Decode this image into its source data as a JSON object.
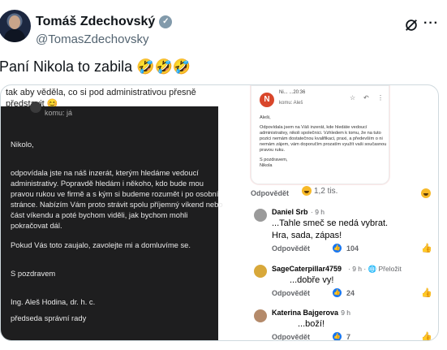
{
  "header": {
    "name": "Tomáš Zdechovský",
    "handle": "@TomasZdechovsky",
    "verified_color": "#829aab",
    "icons": [
      "grok-icon",
      "more-icon"
    ]
  },
  "tweet": {
    "text": "Paní Nikola to zabila 🤣🤣🤣"
  },
  "media": {
    "top_text_1": "tak aby věděla, co si pod administrativou přesně",
    "top_text_2": "představit 😊",
    "dark_email": {
      "to": "komu: já",
      "greeting": "Nikolo,",
      "p1": [
        "odpovídala jste na náš inzerát, kterým hledáme vedoucí",
        "administrativy. Popravdě hledám i někoho, kdo bude mou",
        "pravou rukou ve firmě a s kým si budeme rozumět i po osobní",
        "stránce. Nabízím Vám proto strávit spolu příjemný víkend nebo",
        "část víkendu a poté bychom viděli, jak bychom mohli",
        "pokračovat dál."
      ],
      "p2": "Pokud Vás toto zaujalo, zavolejte mi a domluvíme se.",
      "closing": "S pozdravem",
      "signature": "Ing. Aleš Hodina, dr. h. c.",
      "role": "předseda správní rady"
    },
    "reply_email": {
      "avatar_letter": "N",
      "sender": "Ni...   ...20:36",
      "to": "komu: Aleš",
      "greeting": "Aleši,",
      "body": "Odpovídala jsem na Váš inzerát, kde hledáte vedoucí administrativy, nikoli společnici. Vzhledem k tomu, že na tuto pozici nemám dostatečnou kvalifikaci, praxi, a především o ni nemám zájem, vám doporučím prozatím využít vaši současnou pravou ruku.",
      "closing": "S pozdravem,",
      "signature": "Nikola"
    },
    "post_actions": {
      "reply": "Odpovědět",
      "reaction_count": "1,2 tis."
    },
    "comments": [
      {
        "name": "Daniel Srb",
        "meta": "· 9 h",
        "text": "...Tahle smeč se nedá vybrat.",
        "text2": "Hra, sada, zápas!",
        "reply": "Odpovědět",
        "likes": "104"
      },
      {
        "name": "SageCaterpillar4759",
        "meta": "· 9 h · 🌐 Přeložit",
        "text": "...dobře vy!",
        "reply": "Odpovědět",
        "likes": "24"
      },
      {
        "name": "Katerina Bajgerova",
        "meta": "· 9 h",
        "text": "...boží!",
        "reply": "Odpovědět",
        "likes": "7"
      }
    ]
  },
  "colors": {
    "facebook_blue": "#1877f2",
    "dark_bg": "#1e1e1f",
    "reply_avatar": "#d9472b"
  }
}
